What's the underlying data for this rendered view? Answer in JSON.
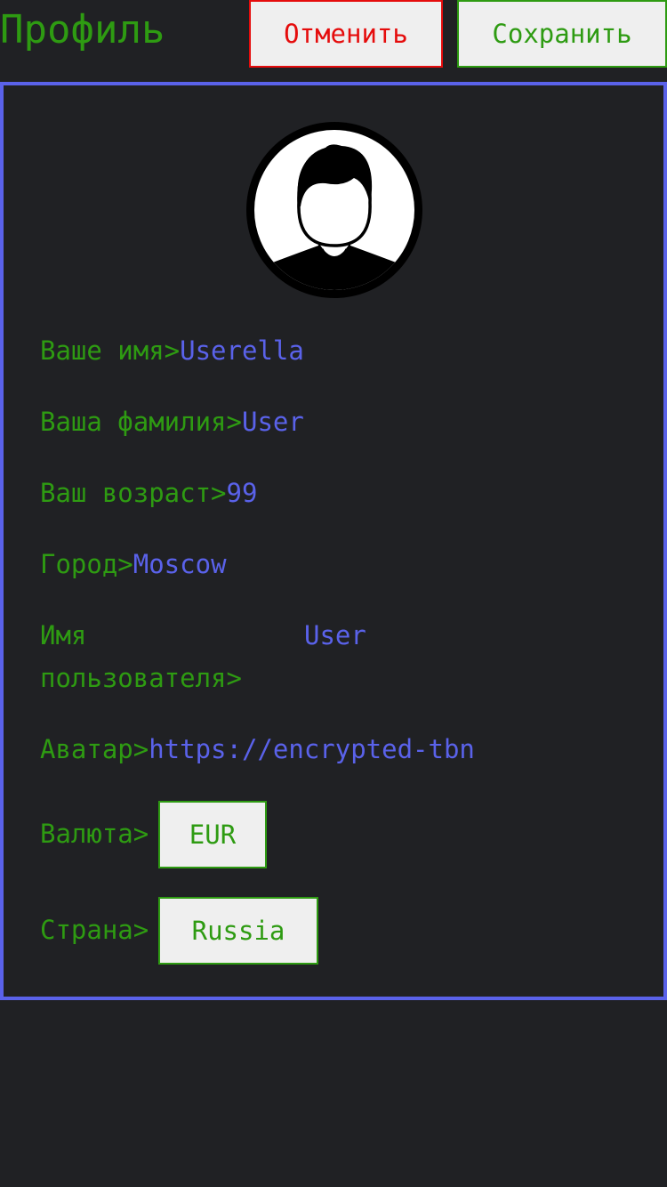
{
  "header": {
    "title": "Профиль",
    "cancel_label": "Отменить",
    "save_label": "Сохранить"
  },
  "profile": {
    "first_name": {
      "label": "Ваше имя>",
      "value": "Userella"
    },
    "last_name": {
      "label": "Ваша фамилия>",
      "value": "User"
    },
    "age": {
      "label": "Ваш возраст>",
      "value": "99"
    },
    "city": {
      "label": "Город>",
      "value": "Moscow"
    },
    "username": {
      "label_line1": "Имя",
      "label_line2": "пользователя>",
      "value": "User"
    },
    "avatar_url": {
      "label": "Аватар>",
      "value": "https://encrypted-tbn"
    },
    "currency": {
      "label": "Валюта>",
      "value": "EUR"
    },
    "country": {
      "label": "Страна>",
      "value": "Russia"
    }
  },
  "colors": {
    "background": "#202124",
    "label_green": "#2e9b12",
    "value_blue": "#5a62ea",
    "cancel_red": "#e50c0c",
    "button_bg": "#efefef"
  },
  "icons": {
    "avatar": "user-avatar-icon"
  }
}
